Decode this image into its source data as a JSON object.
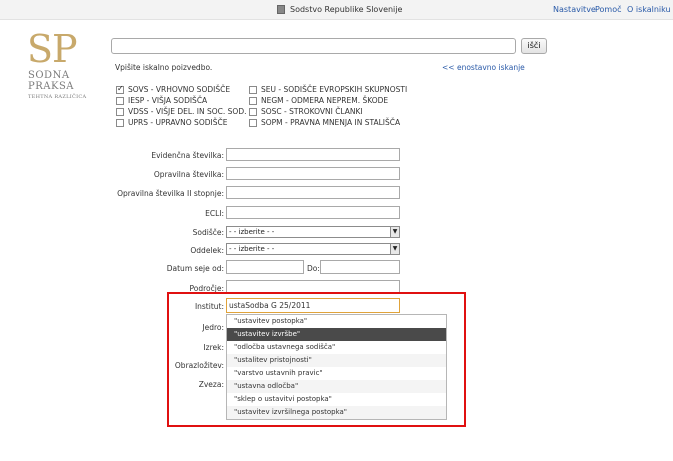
{
  "header": {
    "court_title": "Sodstvo Republike Slovenije",
    "links": [
      "Nastavitve",
      "Pomoč",
      "O iskalniku"
    ]
  },
  "logo": {
    "initials": "SP",
    "line1": "SODNA",
    "line2": "PRAKSA",
    "tagline": "TEHTNA RAZLIČICA"
  },
  "search": {
    "query": "",
    "button_label": "išči",
    "hint": "Vpišite iskalno poizvedbo.",
    "simple_link": "<< enostavno iskanje"
  },
  "databases": [
    {
      "label": "SOVS - VRHOVNO SODIŠČE",
      "checked": true
    },
    {
      "label": "IESP - VIŠJA SODIŠČA",
      "checked": false
    },
    {
      "label": "VDSS - VIŠJE DEL. IN SOC. SOD.",
      "checked": false
    },
    {
      "label": "UPRS - UPRAVNO SODIŠČE",
      "checked": false
    },
    {
      "label": "SEU - SODIŠČE EVROPSKIH SKUPNOSTI",
      "checked": false
    },
    {
      "label": "NEGM - ODMERA NEPREM. ŠKODE",
      "checked": false
    },
    {
      "label": "SOSC - STROKOVNI ČLANKI",
      "checked": false
    },
    {
      "label": "SOPM - PRAVNA MNENJA IN STALIŠČA",
      "checked": false
    }
  ],
  "form": {
    "evidencna": "Evidenčna številka:",
    "opravilna": "Opravilna številka:",
    "opravilna2": "Opravilna številka II stopnje:",
    "ecli": "ECLI:",
    "sodisce_label": "Sodišče:",
    "sodisce_value": "- - izberite - -",
    "oddelek_label": "Oddelek:",
    "oddelek_value": "- - izberite - -",
    "datum_label": "Datum seje od:",
    "do_label": "Do:",
    "podrocje": "Področje:",
    "institut_label": "Institut:",
    "institut_value": "ustaSodba G 25/2011",
    "jedro": "Jedro:",
    "izrek": "Izrek:",
    "obrazlozitev": "Obrazložitev:",
    "zveza": "Zveza:"
  },
  "autocomplete": {
    "items": [
      "\"ustavitev postopka\"",
      "\"ustavitev izvršbe\"",
      "\"odločba ustavnega sodišča\"",
      "\"ustalitev pristojnosti\"",
      "\"varstvo ustavnih pravic\"",
      "\"ustavna odločba\"",
      "\"sklep o ustavitvi postopka\"",
      "\"ustavitev izvršilnega postopka\""
    ],
    "selected_index": 1
  },
  "colors": {
    "highlight": "#e01010",
    "link": "#2a5aa8",
    "logo_gold": "#c8a96b",
    "selected_row": "#4a4a4a"
  }
}
